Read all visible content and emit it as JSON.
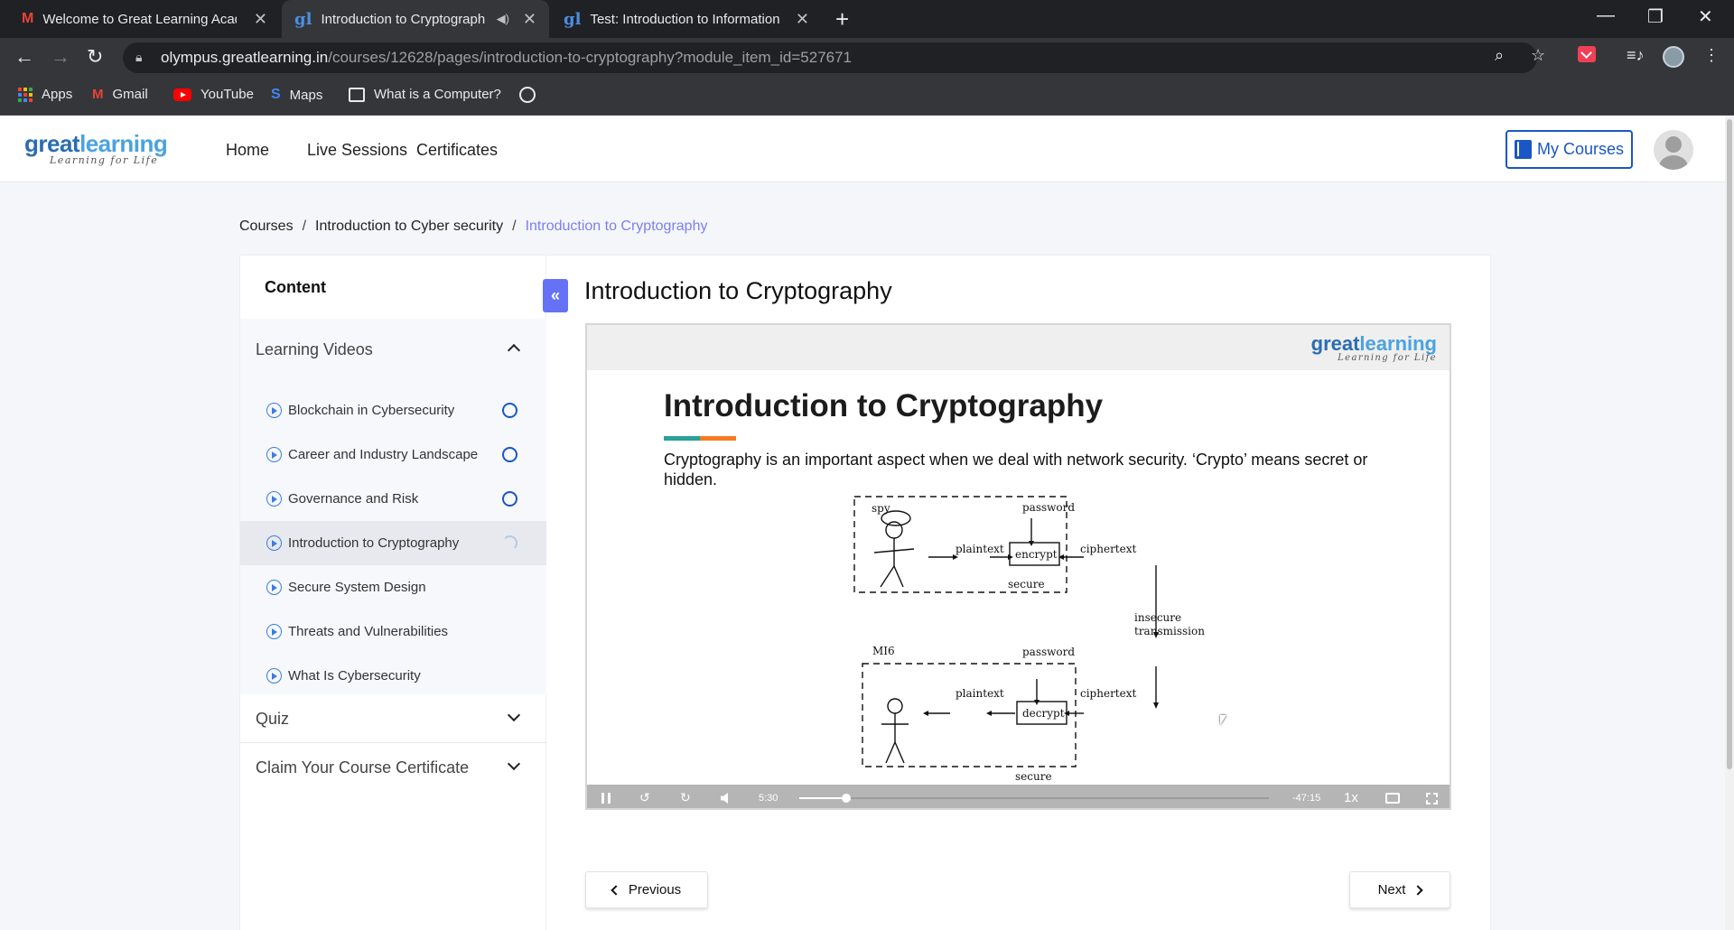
{
  "browser": {
    "tabs": [
      {
        "title": "Welcome to Great Learning Acad",
        "icon": "gmail-icon"
      },
      {
        "title": "Introduction to Cryptograph",
        "icon": "greatlearning-icon",
        "active": true,
        "audio": true
      },
      {
        "title": "Test: Introduction to Information",
        "icon": "greatlearning-icon"
      }
    ],
    "url_host": "olympus.greatlearning.in",
    "url_path": "/courses/12628/pages/introduction-to-cryptography?module_item_id=527671",
    "bookmarks": [
      {
        "label": "Apps",
        "icon": "apps-grid-icon"
      },
      {
        "label": "Gmail",
        "icon": "gmail-icon"
      },
      {
        "label": "YouTube",
        "icon": "youtube-icon"
      },
      {
        "label": "Maps",
        "icon": "maps-icon"
      },
      {
        "label": "What is a Computer?",
        "icon": "document-icon"
      }
    ]
  },
  "site": {
    "logo_wordmark_a": "great",
    "logo_wordmark_b": "learning",
    "logo_tagline": "Learning for Life",
    "nav": [
      "Home",
      "Live Sessions",
      "Certificates"
    ],
    "my_courses_label": "My Courses"
  },
  "breadcrumb": {
    "items": [
      "Courses",
      "Introduction to Cyber security"
    ],
    "current": "Introduction to Cryptography",
    "separator": "/"
  },
  "sidebar": {
    "heading": "Content",
    "open_section": "Learning Videos",
    "lessons": [
      {
        "title": "Blockchain in Cybersecurity",
        "state": "not-started"
      },
      {
        "title": "Career and Industry Landscape",
        "state": "not-started"
      },
      {
        "title": "Governance and Risk",
        "state": "not-started"
      },
      {
        "title": "Introduction to Cryptography",
        "state": "in-progress"
      },
      {
        "title": "Secure System Design",
        "state": "none"
      },
      {
        "title": "Threats and Vulnerabilities",
        "state": "none"
      },
      {
        "title": "What Is Cybersecurity",
        "state": "none"
      }
    ],
    "closed_sections": [
      "Quiz",
      "Claim Your Course Certificate"
    ],
    "collapse_icon": "double-chevron-left-icon"
  },
  "lesson": {
    "title": "Introduction to Cryptography"
  },
  "video": {
    "slide_heading": "Introduction to Cryptography",
    "slide_text": "Cryptography is an important aspect when we deal with network security. ‘Crypto’ means secret or hidden.",
    "slide_logo_a": "great",
    "slide_logo_b": "learning",
    "slide_logo_tag": "Learning for Life",
    "diagram_labels": {
      "spy": "spy",
      "password_top": "password",
      "plaintext_top": "plaintext",
      "encrypt": "encrypt",
      "ciphertext_top": "ciphertext",
      "secure_top": "secure",
      "insecure": "insecure",
      "transmission": "transmission",
      "mi6": "MI6",
      "password_bottom": "password",
      "plaintext_bottom": "plaintext",
      "decrypt": "decrypt",
      "ciphertext_bottom": "ciphertext",
      "secure_bottom": "secure"
    },
    "elapsed": "5:30",
    "remaining": "-47:15",
    "speed": "1x",
    "progress_fraction": 0.1,
    "accent_teal": "#2aa198",
    "accent_orange": "#f47b20"
  },
  "pager": {
    "previous_label": "Previous",
    "next_label": "Next"
  },
  "colors": {
    "brand_blue": "#1a56c5",
    "collapse_button": "#6672f5",
    "breadcrumb_current": "#7b7ff0"
  }
}
